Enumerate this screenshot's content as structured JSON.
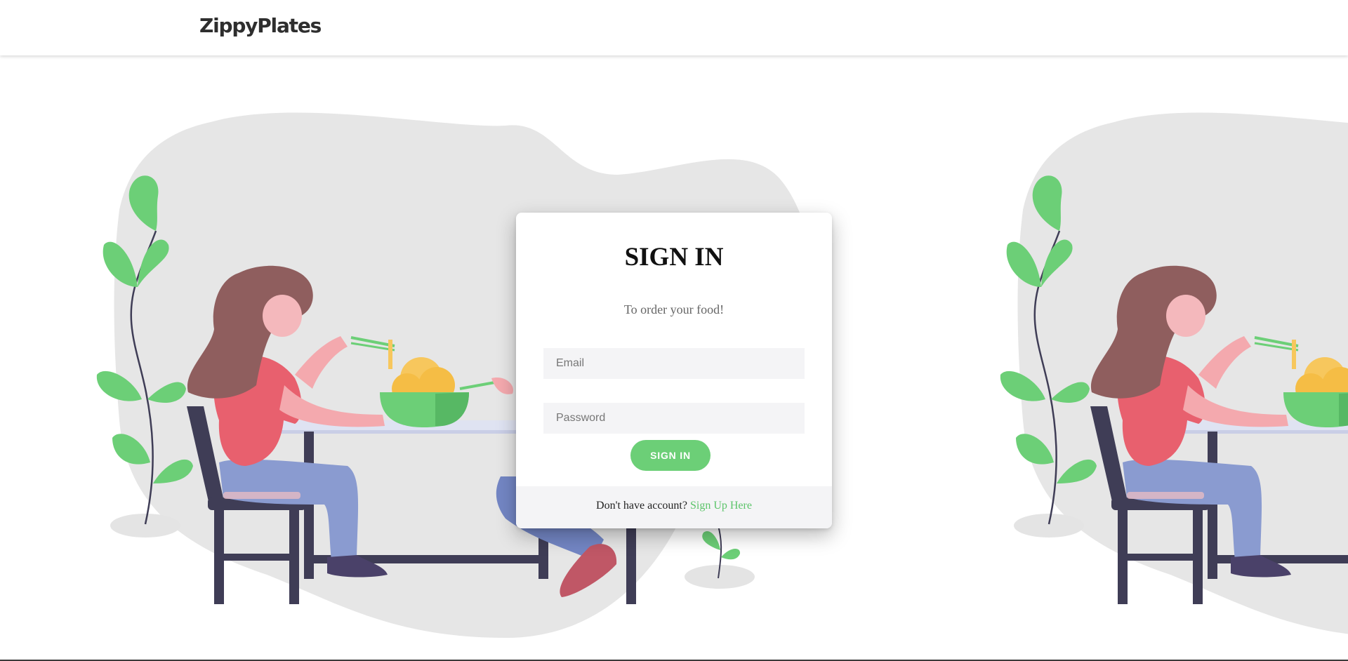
{
  "brand": {
    "name": "ZippyPlates"
  },
  "signin": {
    "title": "SIGN IN",
    "subtitle": "To order your food!",
    "email_placeholder": "Email",
    "email_value": "",
    "password_placeholder": "Password",
    "password_value": "",
    "button_label": "SIGN IN"
  },
  "footer": {
    "prompt": "Don't have account?",
    "link_label": "Sign Up Here"
  },
  "colors": {
    "accent": "#6ccf77",
    "link": "#5cc46a",
    "blob": "#e6e6e6",
    "shirt": "#e8606e",
    "hair": "#8f5e5e",
    "pants": "#8a9bd0"
  },
  "illustration": {
    "name": "woman-eating-noodles-illustration"
  }
}
